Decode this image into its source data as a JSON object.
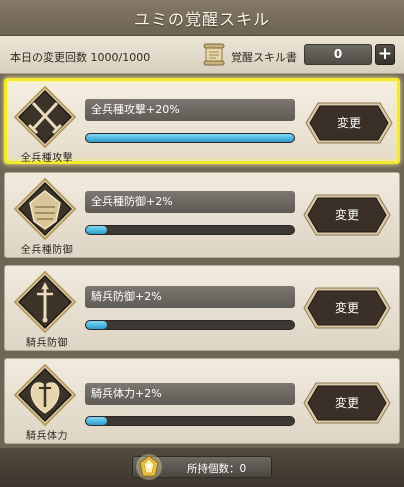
{
  "header": {
    "title": "ユミの覚醒スキル"
  },
  "info": {
    "change_count_label": "本日の変更回数 1000/1000",
    "book_label": "覚醒スキル書",
    "book_count": "0",
    "plus_label": "+"
  },
  "skills": [
    {
      "label": "全兵種攻撃",
      "name": "全兵種攻撃+20%",
      "progress": 1.0,
      "button": "変更",
      "selected": true
    },
    {
      "label": "全兵種防御",
      "name": "全兵種防御+2%",
      "progress": 0.1,
      "button": "変更",
      "selected": false
    },
    {
      "label": "騎兵防御",
      "name": "騎兵防御+2%",
      "progress": 0.1,
      "button": "変更",
      "selected": false
    },
    {
      "label": "騎兵体力",
      "name": "騎兵体力+2%",
      "progress": 0.1,
      "button": "変更",
      "selected": false
    }
  ],
  "footer": {
    "owned_label": "所持個数：0"
  },
  "colors": {
    "highlight": "#f3ea2e",
    "progress": "#2a9ccd",
    "button": "#3a3027"
  },
  "icons": [
    "scroll-icon",
    "crossed-swords-icon",
    "shield-icon",
    "sword-icon",
    "heart-icon",
    "gem-icon"
  ]
}
